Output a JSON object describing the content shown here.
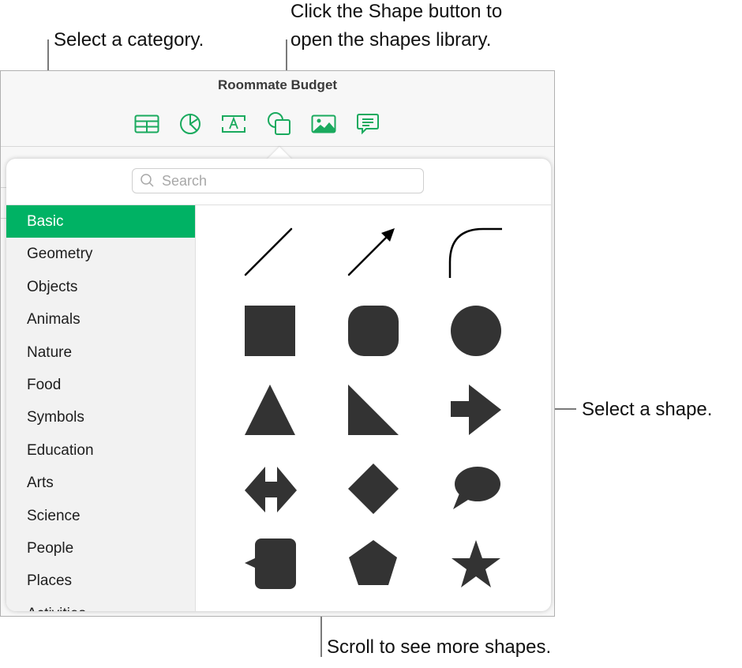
{
  "callouts": {
    "select_category": "Select a category.",
    "shape_button_line1": "Click the Shape button to",
    "shape_button_line2": "open the shapes library.",
    "select_shape": "Select a shape.",
    "scroll_more": "Scroll to see more shapes."
  },
  "window": {
    "title": "Roommate Budget"
  },
  "toolbar": {
    "accent_color": "#1aaa5e",
    "buttons": [
      {
        "name": "table",
        "icon": "table-icon"
      },
      {
        "name": "chart",
        "icon": "chart-icon"
      },
      {
        "name": "text",
        "icon": "text-box-icon"
      },
      {
        "name": "shape",
        "icon": "shape-icon"
      },
      {
        "name": "media",
        "icon": "media-icon"
      },
      {
        "name": "comment",
        "icon": "comment-icon"
      }
    ]
  },
  "shapes_library": {
    "search": {
      "placeholder": "Search",
      "value": ""
    },
    "selected_color": "#00b264",
    "categories": [
      {
        "label": "Basic",
        "selected": true
      },
      {
        "label": "Geometry",
        "selected": false
      },
      {
        "label": "Objects",
        "selected": false
      },
      {
        "label": "Animals",
        "selected": false
      },
      {
        "label": "Nature",
        "selected": false
      },
      {
        "label": "Food",
        "selected": false
      },
      {
        "label": "Symbols",
        "selected": false
      },
      {
        "label": "Education",
        "selected": false
      },
      {
        "label": "Arts",
        "selected": false
      },
      {
        "label": "Science",
        "selected": false
      },
      {
        "label": "People",
        "selected": false
      },
      {
        "label": "Places",
        "selected": false
      },
      {
        "label": "Activities",
        "selected": false
      }
    ],
    "shapes": [
      "line",
      "arrow-line",
      "curve",
      "square",
      "rounded-square",
      "circle",
      "triangle",
      "right-triangle",
      "arrow",
      "double-arrow",
      "diamond",
      "speech-bubble",
      "callout-square",
      "pentagon",
      "star"
    ]
  }
}
